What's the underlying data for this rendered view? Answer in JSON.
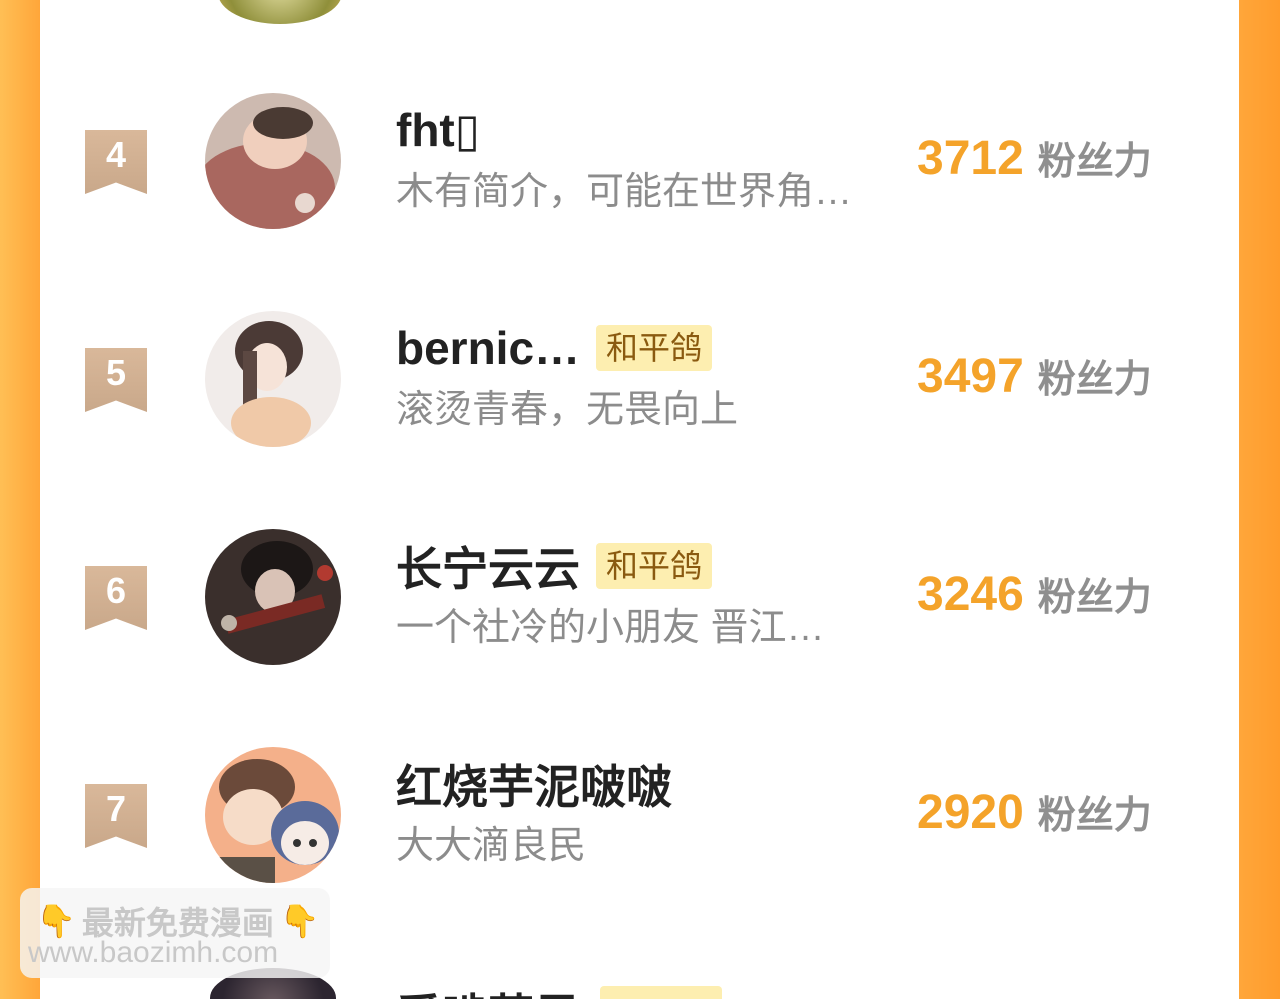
{
  "colors": {
    "page_background": "#ffa63a",
    "score": "#f4a32a",
    "badge_background": "#fdeeb0",
    "rank_ribbon": "#d2b193"
  },
  "ranking": {
    "unit_label": "粉丝力",
    "items": [
      {
        "rank": "4",
        "name": "fht▯",
        "badge": "",
        "bio": "木有简介，可能在世界角…",
        "score": "3712"
      },
      {
        "rank": "5",
        "name": "bernic…",
        "badge": "和平鸽",
        "bio": "滚烫青春，无畏向上",
        "score": "3497"
      },
      {
        "rank": "6",
        "name": "长宁云云",
        "badge": "和平鸽",
        "bio": "一个社冷的小朋友 晋江…",
        "score": "3246"
      },
      {
        "rank": "7",
        "name": "红烧芋泥啵啵",
        "badge": "",
        "bio": "大大滴良民",
        "score": "2920"
      }
    ],
    "partial_next_name": "爱啃苹果"
  },
  "watermark": {
    "line1": "最新免费漫画",
    "line2": "www.baozimh.com"
  }
}
